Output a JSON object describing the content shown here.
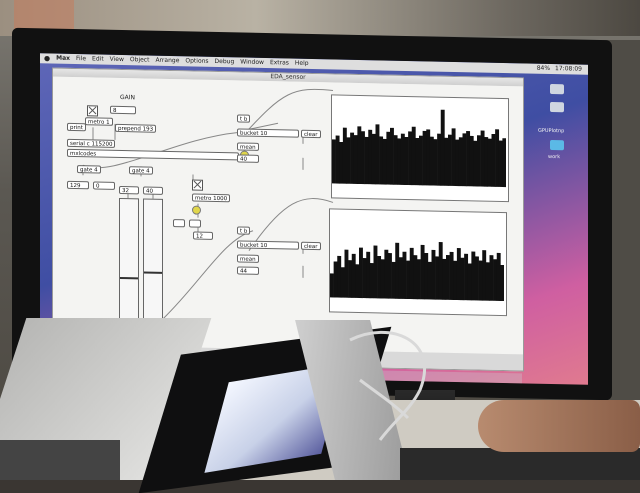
{
  "menubar": {
    "items": [
      "Max",
      "File",
      "Edit",
      "View",
      "Object",
      "Arrange",
      "Options",
      "Debug",
      "Window",
      "Extras",
      "Help"
    ],
    "battery": "84%",
    "clock": "17:08:09"
  },
  "window": {
    "title": "EDA_sensor"
  },
  "patch": {
    "gain_label": "GAIN",
    "gain_value": "8",
    "print_label": "print",
    "metro1_label": "metro 1",
    "prepend_label": "prepend 193",
    "serial_label": "serial c 115200",
    "mxlcodes_label": "mxlcodes",
    "gate_left_label": "gate 4",
    "gate_right_label": "gate 4",
    "num_a": "129",
    "num_b": "0",
    "num_c": "32",
    "num_d": "40",
    "metro1000_label": "metro 1000",
    "num_e": "12",
    "top": {
      "trigger": "t b",
      "bucket": "bucket 10",
      "mean": "mean",
      "value": "40",
      "clear": "clear"
    },
    "bottom": {
      "trigger": "t b",
      "bucket": "bucket 10",
      "mean": "mean",
      "value": "44",
      "clear": "clear"
    }
  },
  "sidebar": {
    "item1": "GPUPlotnp",
    "item2": "work"
  },
  "colors": {
    "bang": "#e0d64a",
    "desktop_top": "#5f67b8",
    "desktop_bottom": "#e07a8f"
  },
  "chart_data": [
    {
      "type": "area",
      "series": [
        {
          "values": [
            55,
            60,
            52,
            70,
            58,
            64,
            61,
            72,
            66,
            59,
            68,
            63,
            75,
            60,
            57,
            66,
            71,
            62,
            58,
            64,
            60,
            67,
            73,
            59,
            62,
            68,
            70,
            61,
            58,
            65,
            95,
            60,
            64,
            72,
            58,
            61,
            66,
            69,
            63,
            57,
            64,
            70,
            62,
            60,
            66,
            72,
            58,
            61
          ]
        }
      ]
    },
    {
      "type": "area",
      "series": [
        {
          "values": [
            30,
            45,
            52,
            38,
            60,
            47,
            55,
            42,
            63,
            50,
            58,
            44,
            66,
            53,
            49,
            61,
            57,
            46,
            70,
            52,
            59,
            48,
            64,
            55,
            50,
            68,
            58,
            47,
            62,
            54,
            72,
            51,
            56,
            60,
            49,
            65,
            53,
            58,
            46,
            61,
            55,
            50,
            63,
            48,
            57,
            52,
            60,
            45
          ]
        }
      ]
    }
  ]
}
